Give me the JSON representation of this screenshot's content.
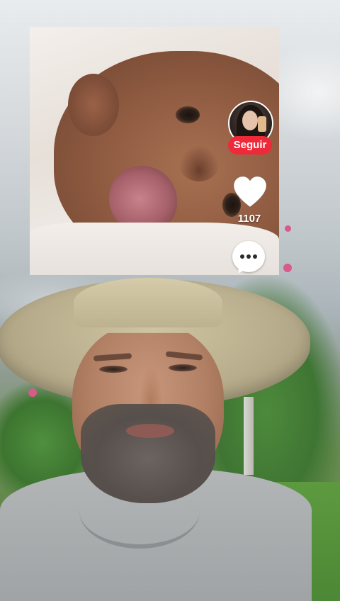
{
  "inset_video": {
    "creator": {
      "follow_label": "Seguir",
      "avatar_icon": "profile-avatar-icon"
    },
    "actions": {
      "like_icon": "heart-icon",
      "like_count": "1107",
      "comment_icon": "speech-bubble-icon"
    }
  },
  "colors": {
    "follow_button": "#ee2a3a",
    "icon_fill": "#ffffff",
    "count_text": "#ffffff"
  }
}
